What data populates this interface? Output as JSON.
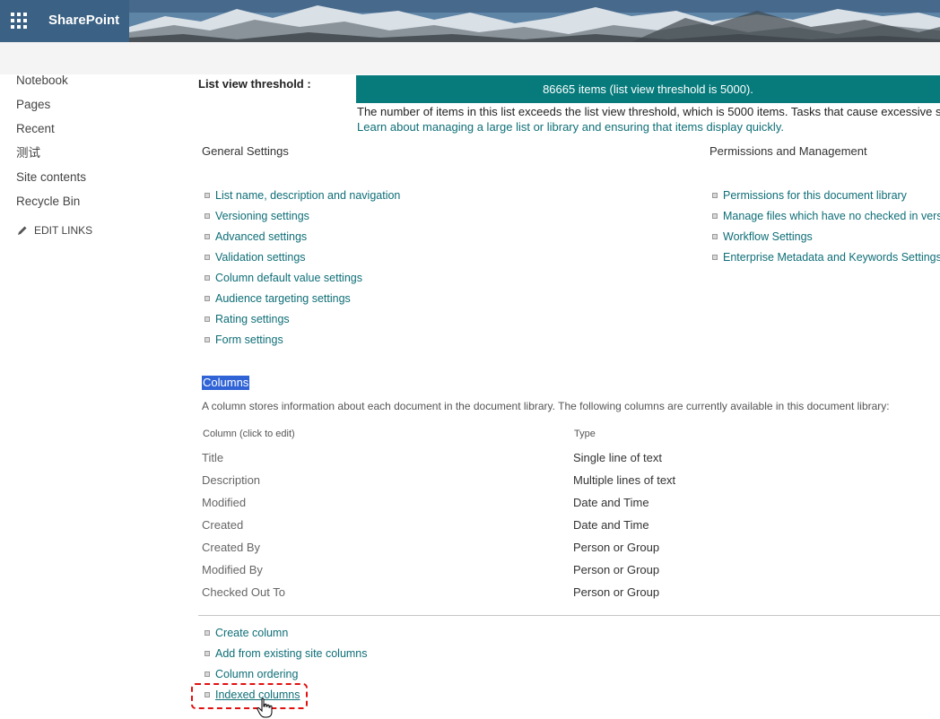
{
  "suite_bar": {
    "brand": "SharePoint",
    "waffle_icon": "app-launcher-icon"
  },
  "left_nav": {
    "items": [
      "Notebook",
      "Pages",
      "Recent",
      "测试",
      "Site contents",
      "Recycle Bin"
    ],
    "edit_links": "EDIT LINKS",
    "edit_icon": "pencil-icon"
  },
  "threshold": {
    "label": "List view threshold :",
    "banner": "86665 items (list view threshold is 5000).",
    "message": "The number of items in this list exceeds the list view threshold, which is 5000 items. Tasks that cause excessive serv",
    "learn_link": "Learn about managing a large list or library and ensuring that items display quickly."
  },
  "general_settings": {
    "heading": "General Settings",
    "links": [
      "List name, description and navigation",
      "Versioning settings",
      "Advanced settings",
      "Validation settings",
      "Column default value settings",
      "Audience targeting settings",
      "Rating settings",
      "Form settings"
    ]
  },
  "permissions": {
    "heading": "Permissions and Management",
    "links": [
      "Permissions for this document library",
      "Manage files which have no checked in version",
      "Workflow Settings",
      "Enterprise Metadata and Keywords Settings"
    ]
  },
  "columns": {
    "heading": "Columns",
    "description": "A column stores information about each document in the document library. The following columns are currently available in this document library:",
    "header_name": "Column (click to edit)",
    "header_type": "Type",
    "rows": [
      {
        "name": "Title",
        "type": "Single line of text"
      },
      {
        "name": "Description",
        "type": "Multiple lines of text"
      },
      {
        "name": "Modified",
        "type": "Date and Time"
      },
      {
        "name": "Created",
        "type": "Date and Time"
      },
      {
        "name": "Created By",
        "type": "Person or Group"
      },
      {
        "name": "Modified By",
        "type": "Person or Group"
      },
      {
        "name": "Checked Out To",
        "type": "Person or Group"
      }
    ],
    "actions": [
      "Create column",
      "Add from existing site columns",
      "Column ordering",
      "Indexed columns"
    ]
  },
  "colors": {
    "accent_teal": "#077b7c",
    "link": "#0e6e77",
    "selection": "#2f63d6",
    "highlight_border": "#e21010"
  }
}
